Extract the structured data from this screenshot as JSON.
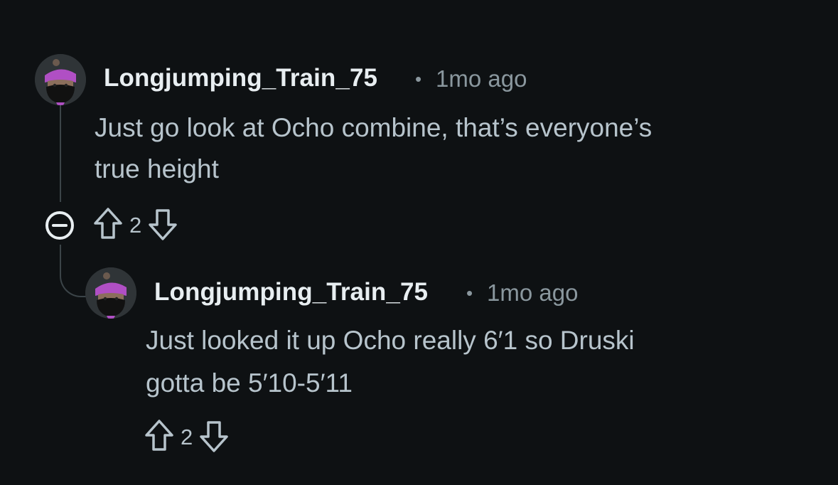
{
  "comments": [
    {
      "username": "Longjumping_Train_75",
      "separator": "•",
      "timestamp": "1mo ago",
      "body_lines": [
        "Just go look at Ocho combine, that’s everyone’s",
        "true height"
      ],
      "votes": "2",
      "collapse_icon": "collapse-minus-icon",
      "upvote_icon": "upvote-arrow-icon",
      "downvote_icon": "downvote-arrow-icon"
    },
    {
      "username": "Longjumping_Train_75",
      "separator": "•",
      "timestamp": "1mo ago",
      "body_lines": [
        "Just looked it up Ocho really 6′1 so Druski",
        "gotta be 5′10-5′11"
      ],
      "votes": "2",
      "upvote_icon": "upvote-arrow-icon",
      "downvote_icon": "downvote-arrow-icon"
    }
  ],
  "colors": {
    "background": "#0e1113",
    "username": "#e8eef1",
    "body_text": "#b7c4cc",
    "meta_text": "#8a979e",
    "thread_line": "#3b4448",
    "avatar_bandana": "#b04fc4"
  }
}
